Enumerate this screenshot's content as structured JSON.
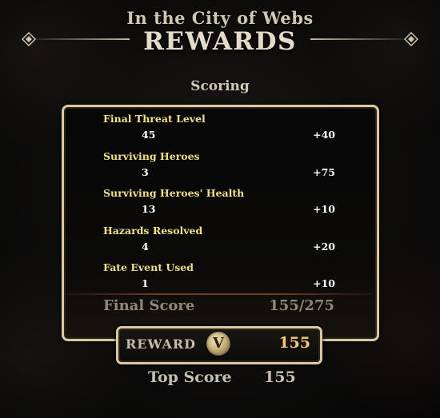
{
  "header": {
    "subtitle": "In the City of Webs",
    "title": "REWARDS"
  },
  "scoring": {
    "label": "Scoring",
    "rows": [
      {
        "label": "Final Threat Level",
        "value": "45",
        "points": "+40"
      },
      {
        "label": "Surviving Heroes",
        "value": "3",
        "points": "+75"
      },
      {
        "label": "Surviving Heroes' Health",
        "value": "13",
        "points": "+10"
      },
      {
        "label": "Hazards Resolved",
        "value": "4",
        "points": "+20"
      },
      {
        "label": "Fate Event Used",
        "value": "1",
        "points": "+10"
      }
    ],
    "final_label": "Final Score",
    "final_value": "155/275"
  },
  "reward": {
    "label": "REWARD",
    "badge": "V",
    "value": "155"
  },
  "top_score": {
    "label": "Top Score",
    "value": "155"
  },
  "colors": {
    "accent_gold": "#d8c9a3",
    "row_label": "#f0e08a",
    "reward_value": "#f4c77a"
  },
  "icons": [
    "diamond-ornament-icon",
    "v-coin-icon"
  ]
}
